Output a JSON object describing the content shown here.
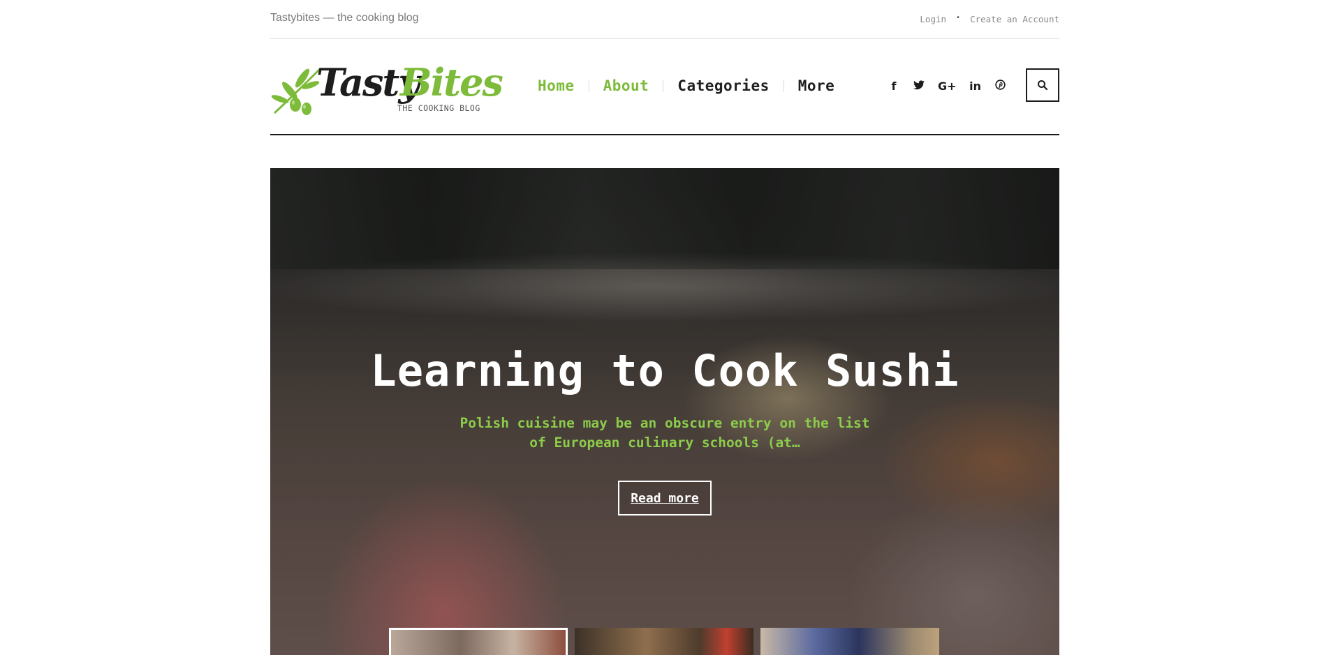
{
  "topbar": {
    "tagline": "Tastybites — the cooking blog",
    "login": "Login",
    "separator": "•",
    "create_account": "Create an Account"
  },
  "logo": {
    "word1": "Tasty",
    "word2": "Bites",
    "subtitle": "THE COOKING BLOG"
  },
  "nav": {
    "items": [
      {
        "label": "Home",
        "active": true
      },
      {
        "label": "About",
        "active": true
      },
      {
        "label": "Categories",
        "active": false
      },
      {
        "label": "More",
        "active": false
      }
    ]
  },
  "social": {
    "facebook": "f",
    "twitter": "twitter-icon",
    "googleplus": "G+",
    "linkedin": "in",
    "pinterest": "pinterest-icon"
  },
  "search": {
    "icon": "search-icon"
  },
  "hero": {
    "title": "Learning to Cook Sushi",
    "excerpt": "Polish cuisine may be an obscure entry on the list of European culinary schools (at…",
    "cta": "Read more"
  },
  "colors": {
    "accent": "#7dbb3a",
    "dark": "#1b1b1b"
  }
}
